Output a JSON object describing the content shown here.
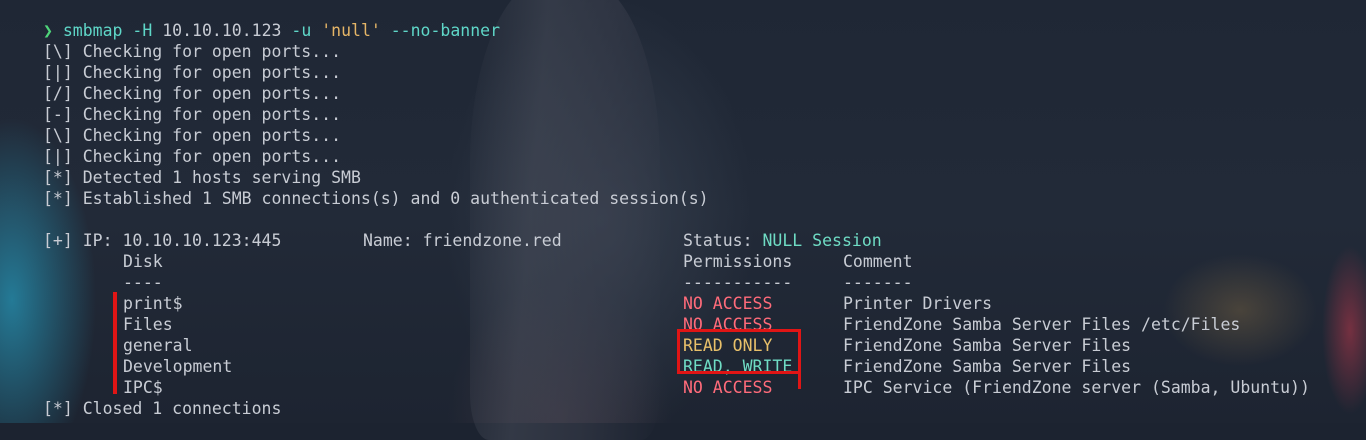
{
  "command": {
    "prompt": "❯",
    "tool": "smbmap",
    "flag_host": "-H",
    "host": "10.10.10.123",
    "flag_user": "-u",
    "user": "'null'",
    "flag_banner": "--no-banner"
  },
  "progress": [
    "[\\] Checking for open ports...",
    "[|] Checking for open ports...",
    "[/] Checking for open ports...",
    "[-] Checking for open ports...",
    "[\\] Checking for open ports...",
    "[|] Checking for open ports..."
  ],
  "detected": "[*] Detected 1 hosts serving SMB",
  "established": "[*] Established 1 SMB connections(s) and 0 authenticated session(s)",
  "host_info": {
    "ip_label": "[+] IP: 10.10.10.123:445",
    "name_label": "Name: friendzone.red",
    "status_label": "Status: ",
    "status_value": "NULL Session"
  },
  "table": {
    "headers": {
      "disk": "Disk",
      "permissions": "Permissions",
      "comment": "Comment"
    },
    "separators": {
      "disk": "----",
      "permissions": "-----------",
      "comment": "-------"
    },
    "rows": [
      {
        "disk": "print$",
        "permissions": "NO ACCESS",
        "comment": "Printer Drivers"
      },
      {
        "disk": "Files",
        "permissions": "NO ACCESS",
        "comment": "FriendZone Samba Server Files /etc/Files"
      },
      {
        "disk": "general",
        "permissions": "READ ONLY",
        "comment": "FriendZone Samba Server Files"
      },
      {
        "disk": "Development",
        "permissions": "READ, WRITE",
        "comment": "FriendZone Samba Server Files"
      },
      {
        "disk": "IPC$",
        "permissions": "NO ACCESS",
        "comment": "IPC Service (FriendZone server (Samba, Ubuntu))"
      }
    ]
  },
  "closed": "[*] Closed 1 connections",
  "colors": {
    "no_access": "#ff6b7a",
    "read_only": "#e8c06a",
    "read_write": "#6fdcc4",
    "highlight": "#e01515"
  }
}
